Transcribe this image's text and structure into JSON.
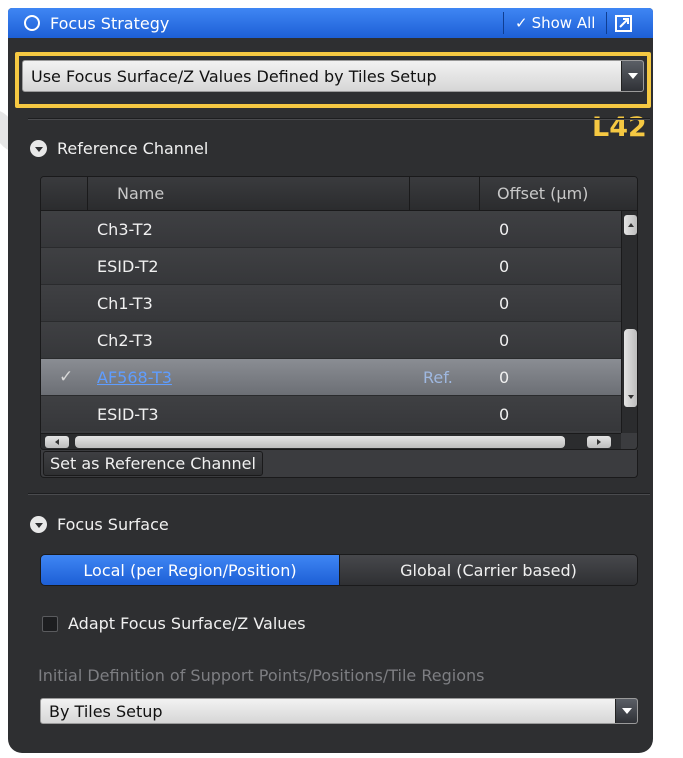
{
  "header": {
    "title": "Focus Strategy",
    "show_all_label": "Show All",
    "show_all_check": "✓"
  },
  "strategy": {
    "selected": "Use Focus Surface/Z Values Defined by Tiles Setup"
  },
  "annotation_tag": "L42",
  "reference_channel": {
    "section_title": "Reference Channel",
    "columns": {
      "name": "Name",
      "offset": "Offset (µm)"
    },
    "rows": [
      {
        "name": "Ch3-T2",
        "ref": "",
        "offset": "0",
        "selected": false
      },
      {
        "name": "ESID-T2",
        "ref": "",
        "offset": "0",
        "selected": false
      },
      {
        "name": "Ch1-T3",
        "ref": "",
        "offset": "0",
        "selected": false
      },
      {
        "name": "Ch2-T3",
        "ref": "",
        "offset": "0",
        "selected": false
      },
      {
        "name": "AF568-T3",
        "ref": "Ref.",
        "offset": "0",
        "selected": true,
        "check": "✓"
      },
      {
        "name": "ESID-T3",
        "ref": "",
        "offset": "0",
        "selected": false
      }
    ],
    "set_reference_button": "Set as Reference Channel"
  },
  "focus_surface": {
    "section_title": "Focus Surface",
    "segments": [
      {
        "label": "Local (per Region/Position)",
        "active": true
      },
      {
        "label": "Global (Carrier based)",
        "active": false
      }
    ],
    "adapt_checkbox_label": "Adapt Focus Surface/Z Values",
    "adapt_checked": false,
    "initial_definition_label": "Initial Definition of Support Points/Positions/Tile Regions",
    "initial_definition_selected": "By Tiles Setup"
  },
  "colors": {
    "accent_blue": "#1d5fd6",
    "highlight_yellow": "#f5c842",
    "panel_bg": "#2e2f31"
  }
}
